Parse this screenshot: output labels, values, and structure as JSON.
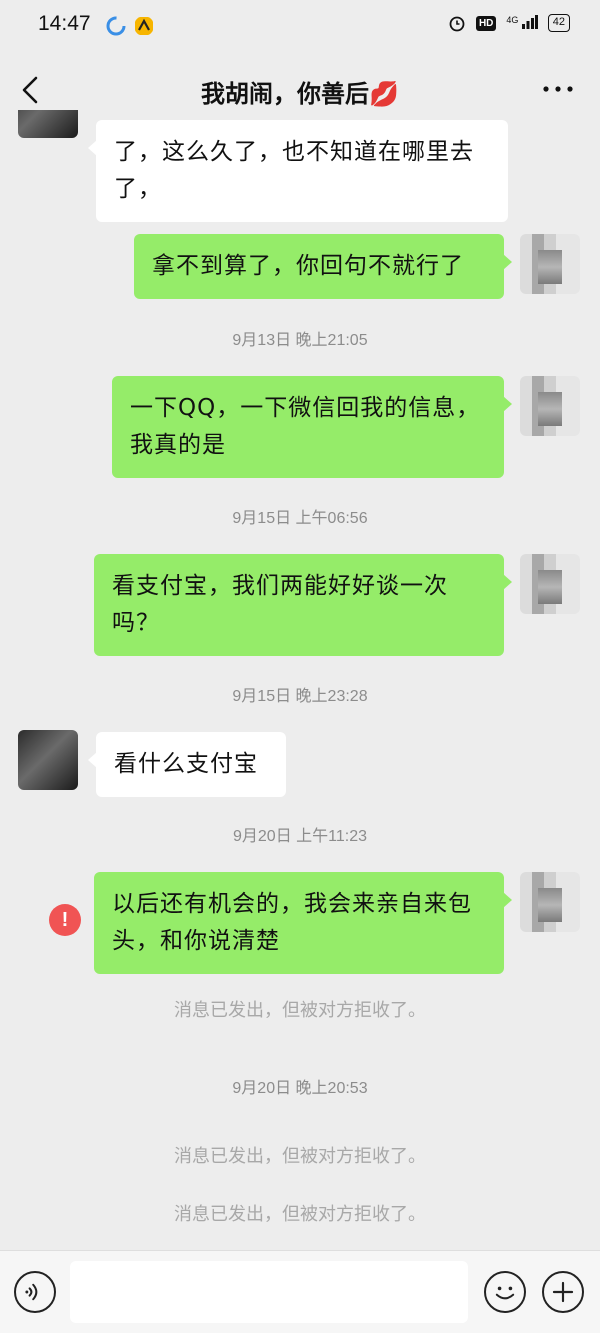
{
  "status_bar": {
    "time": "14:47",
    "hd_label": "HD",
    "signal_label": "4G",
    "battery": "42"
  },
  "header": {
    "title": "我胡闹，你善后💋",
    "back_icon": "chevron-left-icon",
    "more_icon": "more-dots-icon"
  },
  "messages": [
    {
      "type": "in",
      "text": "了，这么久了，也不知道在哪里去了，"
    },
    {
      "type": "out",
      "text": "拿不到算了，你回句不就行了"
    },
    {
      "type": "time",
      "text": "9月13日 晚上21:05"
    },
    {
      "type": "out",
      "text": "一下QQ，一下微信回我的信息，我真的是"
    },
    {
      "type": "time",
      "text": "9月15日 上午06:56"
    },
    {
      "type": "out",
      "text": "看支付宝，我们两能好好谈一次吗？"
    },
    {
      "type": "time",
      "text": "9月15日 晚上23:28"
    },
    {
      "type": "in",
      "text": "看什么支付宝"
    },
    {
      "type": "time",
      "text": "9月20日 上午11:23"
    },
    {
      "type": "out",
      "text": "以后还有机会的，我会来亲自来包头，和你说清楚",
      "status": "failed"
    },
    {
      "type": "notice",
      "text": "消息已发出，但被对方拒收了。"
    },
    {
      "type": "time",
      "text": "9月20日 晚上20:53"
    },
    {
      "type": "notice",
      "text": "消息已发出，但被对方拒收了。"
    },
    {
      "type": "notice",
      "text": "消息已发出，但被对方拒收了。"
    }
  ],
  "input_bar": {
    "voice_icon": "voice-icon",
    "emoji_icon": "emoji-icon",
    "plus_icon": "plus-icon",
    "value": ""
  },
  "colors": {
    "background": "#ededed",
    "outgoing_bubble": "#95ec69",
    "incoming_bubble": "#ffffff",
    "error": "#f05454"
  }
}
